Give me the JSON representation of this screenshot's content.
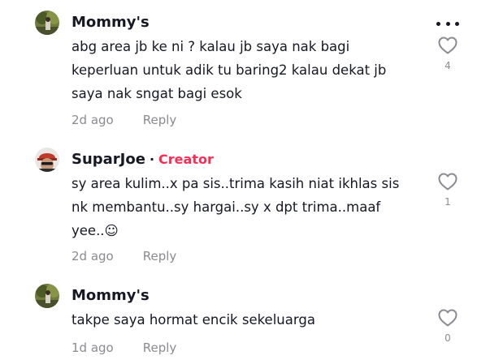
{
  "comments": [
    {
      "author": "Mommy's",
      "text_lines": [
        "abg area jb ke ni ? kalau jb saya nak bagi",
        "keperluan untuk adik tu baring2 kalau dekat jb",
        "saya nak sngat bagi esok"
      ],
      "time": "2d ago",
      "reply_label": "Reply",
      "likes": "4",
      "avatar_icon": "avatar-photo-icon"
    },
    {
      "author": "SuparJoe",
      "separator": "·",
      "badge": "Creator",
      "text_lines": [
        "sy area kulim..x pa sis..trima kasih niat ikhlas sis",
        "nk membantu..sy hargai..sy x dpt trima..maaf",
        "yee..☺"
      ],
      "time": "2d ago",
      "reply_label": "Reply",
      "likes": "1",
      "avatar_icon": "avatar-photo-icon"
    },
    {
      "author": "Mommy's",
      "text_lines": [
        "takpe saya hormat encik sekeluarga"
      ],
      "time": "1d ago",
      "reply_label": "Reply",
      "likes": "0",
      "avatar_icon": "avatar-photo-icon"
    }
  ],
  "colors": {
    "text": "#161823",
    "muted": "#8a8b91",
    "creator_badge": "#fe2c55"
  },
  "icons": {
    "more": "more-horizontal-icon",
    "like": "heart-outline-icon"
  }
}
